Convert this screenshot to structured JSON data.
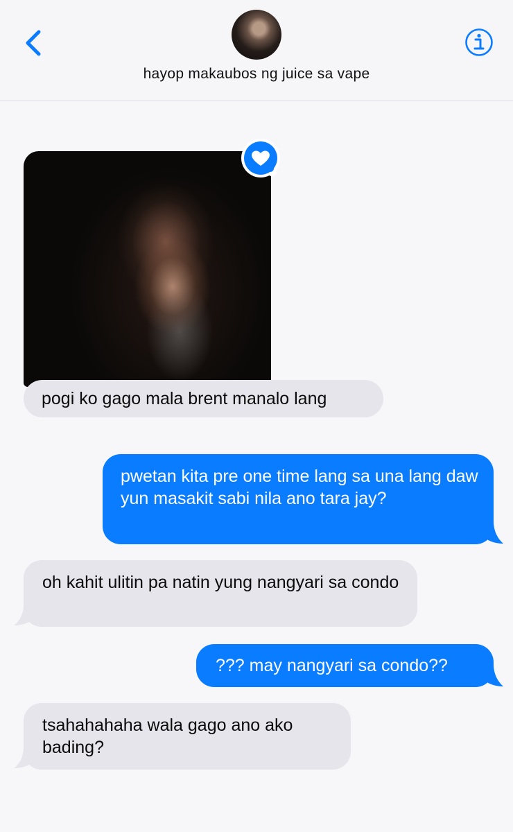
{
  "header": {
    "contact_name": "hayop makaubos ng juice sa vape",
    "back_icon": "chevron-left-icon",
    "info_icon": "info-icon",
    "accent_color": "#0a7cff"
  },
  "messages": [
    {
      "direction": "incoming",
      "type": "photo",
      "tapback": "heart"
    },
    {
      "direction": "incoming",
      "type": "text",
      "text": "pogi ko gago mala brent manalo lang"
    },
    {
      "direction": "outgoing",
      "type": "text",
      "text": "pwetan kita pre one time lang sa una lang daw yun masakit sabi nila ano tara jay?"
    },
    {
      "direction": "incoming",
      "type": "text",
      "text": "oh kahit ulitin pa natin yung nangyari sa condo"
    },
    {
      "direction": "outgoing",
      "type": "text",
      "text": "??? may nangyari sa condo??"
    },
    {
      "direction": "incoming",
      "type": "text",
      "text": "tsahahahaha wala gago ano ako bading?"
    }
  ],
  "colors": {
    "incoming_bubble": "#e6e5eb",
    "outgoing_bubble": "#0a7cff",
    "background": "#f7f7f9"
  }
}
